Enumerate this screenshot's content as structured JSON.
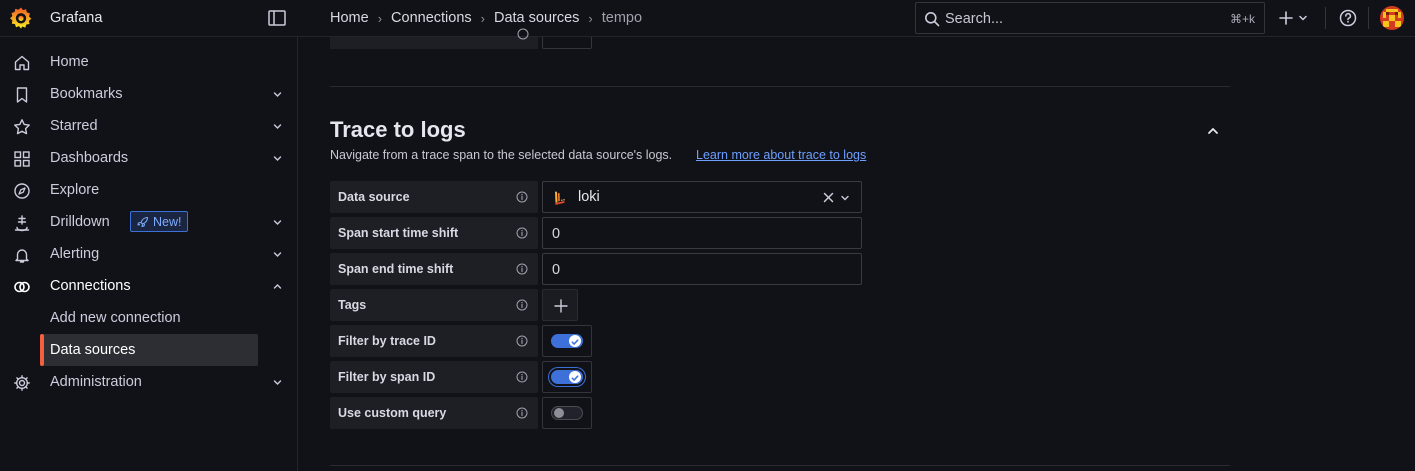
{
  "app": {
    "title": "Grafana"
  },
  "breadcrumbs": [
    "Home",
    "Connections",
    "Data sources",
    "tempo"
  ],
  "search": {
    "placeholder": "Search...",
    "shortcut": "⌘+k"
  },
  "nav": {
    "home": "Home",
    "bookmarks": "Bookmarks",
    "starred": "Starred",
    "dashboards": "Dashboards",
    "explore": "Explore",
    "drilldown": "Drilldown",
    "drilldown_badge": "New!",
    "alerting": "Alerting",
    "connections": "Connections",
    "add_new_connection": "Add new connection",
    "data_sources": "Data sources",
    "administration": "Administration"
  },
  "section": {
    "title": "Trace to logs",
    "description": "Navigate from a trace span to the selected data source's logs.",
    "link": "Learn more about trace to logs"
  },
  "fields": {
    "data_source": {
      "label": "Data source",
      "value": "loki"
    },
    "span_start": {
      "label": "Span start time shift",
      "value": "0"
    },
    "span_end": {
      "label": "Span end time shift",
      "value": "0"
    },
    "tags": {
      "label": "Tags"
    },
    "filter_trace": {
      "label": "Filter by trace ID",
      "checked": true
    },
    "filter_span": {
      "label": "Filter by span ID",
      "checked": true
    },
    "custom_query": {
      "label": "Use custom query",
      "checked": false
    }
  },
  "colors": {
    "accent": "#3d71d9",
    "brand": "#f55f3e",
    "link": "#6e9fff",
    "background": "#111217"
  },
  "icons": [
    "grafana-logo",
    "dock-icon",
    "search-icon",
    "plus-icon",
    "help-icon",
    "home-icon",
    "bookmark-icon",
    "star-icon",
    "dashboards-icon",
    "explore-icon",
    "drilldown-icon",
    "bell-icon",
    "connections-icon",
    "gear-icon",
    "info-icon",
    "loki-icon",
    "close-icon",
    "chevron-down-icon",
    "chevron-up-icon"
  ]
}
